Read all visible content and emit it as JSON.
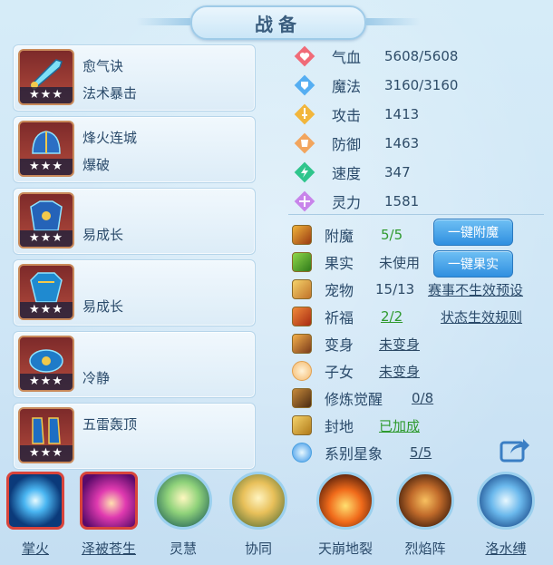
{
  "title": "战备",
  "skills": [
    {
      "name": "愈气诀",
      "sub": "法术暴击",
      "stars": "★★★",
      "icon": "sword-icon"
    },
    {
      "name": "烽火连城",
      "sub": "爆破",
      "stars": "★★★",
      "icon": "helmet-icon"
    },
    {
      "name": "",
      "sub": "易成长",
      "stars": "★★★",
      "icon": "armor-icon"
    },
    {
      "name": "",
      "sub": "易成长",
      "stars": "★★★",
      "icon": "armor-icon"
    },
    {
      "name": "",
      "sub": "冷静",
      "stars": "★★★",
      "icon": "crown-icon"
    },
    {
      "name": "五雷轰顶",
      "sub": "",
      "stars": "★★★",
      "icon": "boots-icon"
    }
  ],
  "stats": [
    {
      "label": "气血",
      "value": "5608/5608",
      "color": "#f05a6a"
    },
    {
      "label": "魔法",
      "value": "3160/3160",
      "color": "#4ea7f0"
    },
    {
      "label": "攻击",
      "value": "1413",
      "color": "#f0b23c"
    },
    {
      "label": "防御",
      "value": "1463",
      "color": "#f0a25a"
    },
    {
      "label": "速度",
      "value": "347",
      "color": "#2fc48a"
    },
    {
      "label": "灵力",
      "value": "1581",
      "color": "#c07be8"
    }
  ],
  "rows": {
    "enchant": {
      "label": "附魔",
      "value": "5/5",
      "button": "一键附魔"
    },
    "fruit": {
      "label": "果实",
      "value": "未使用",
      "button": "一键果实"
    },
    "pet": {
      "label": "宠物",
      "value": "15/13",
      "link": "赛事不生效预设"
    },
    "bless": {
      "label": "祈福",
      "value": "2/2",
      "link": "状态生效规则"
    },
    "transform": {
      "label": "变身",
      "value": "未变身"
    },
    "child": {
      "label": "子女",
      "value": "未变身"
    },
    "cultivation": {
      "label": "修炼觉醒",
      "value": "0/8"
    },
    "land": {
      "label": "封地",
      "value": "已加成"
    },
    "stars": {
      "label": "系别星象",
      "value": "5/5"
    }
  },
  "bottom_skills": [
    {
      "label": "掌火",
      "icon": "fire-orb-icon",
      "selected": true
    },
    {
      "label": "泽被苍生",
      "icon": "hand-glow-icon",
      "selected": true
    },
    {
      "label": "灵慧",
      "icon": "figure-light-icon",
      "selected": false
    },
    {
      "label": "协同",
      "icon": "twin-figure-icon",
      "selected": false
    },
    {
      "label": "天崩地裂",
      "icon": "volcano-icon",
      "selected": false
    },
    {
      "label": "烈焰阵",
      "icon": "flame-glove-icon",
      "selected": false
    },
    {
      "label": "洛水缚",
      "icon": "water-dragon-icon",
      "selected": false
    }
  ]
}
